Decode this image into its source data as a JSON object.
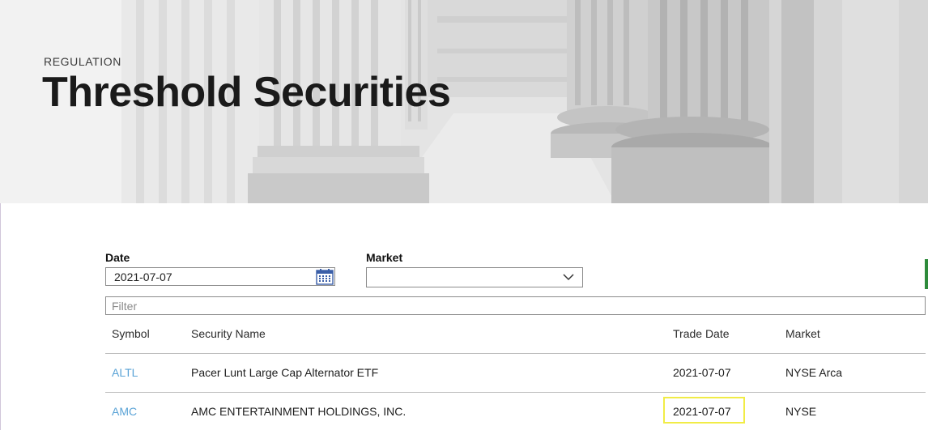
{
  "hero": {
    "eyebrow": "REGULATION",
    "title": "Threshold Securities"
  },
  "filters": {
    "date_label": "Date",
    "date_value": "2021-07-07",
    "market_label": "Market",
    "market_value": "",
    "filter_placeholder": "Filter"
  },
  "table": {
    "headers": [
      "Symbol",
      "Security Name",
      "Trade Date",
      "Market"
    ],
    "rows": [
      {
        "symbol": "ALTL",
        "name": "Pacer Lunt Large Cap Alternator ETF",
        "trade_date": "2021-07-07",
        "market": "NYSE Arca"
      },
      {
        "symbol": "AMC",
        "name": "AMC ENTERTAINMENT HOLDINGS, INC.",
        "trade_date": "2021-07-07",
        "market": "NYSE"
      }
    ]
  },
  "icons": {
    "date_picker": "calendar-icon",
    "market_dropdown": "chevron-down-icon"
  },
  "colors": {
    "symbol_link": "#5aa3d6",
    "highlight": "#f1ec46",
    "side_marker": "#2e8b3b"
  }
}
